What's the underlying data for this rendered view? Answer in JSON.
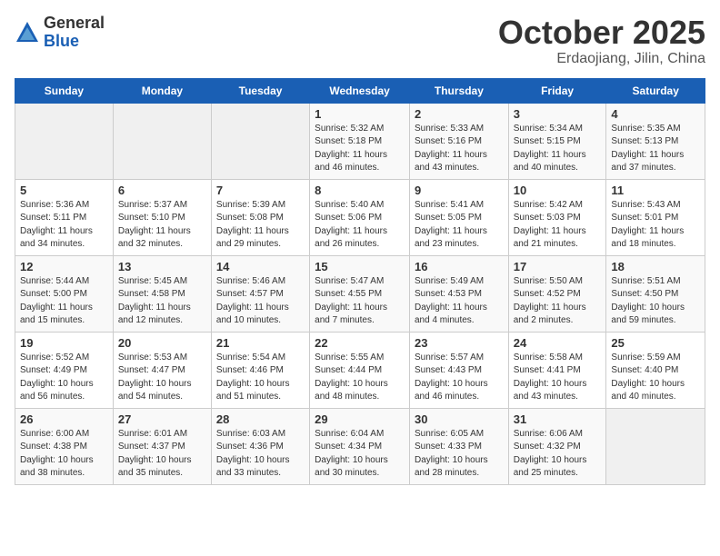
{
  "logo": {
    "general": "General",
    "blue": "Blue"
  },
  "title": "October 2025",
  "location": "Erdaojiang, Jilin, China",
  "days_of_week": [
    "Sunday",
    "Monday",
    "Tuesday",
    "Wednesday",
    "Thursday",
    "Friday",
    "Saturday"
  ],
  "weeks": [
    [
      {
        "day": "",
        "info": ""
      },
      {
        "day": "",
        "info": ""
      },
      {
        "day": "",
        "info": ""
      },
      {
        "day": "1",
        "info": "Sunrise: 5:32 AM\nSunset: 5:18 PM\nDaylight: 11 hours\nand 46 minutes."
      },
      {
        "day": "2",
        "info": "Sunrise: 5:33 AM\nSunset: 5:16 PM\nDaylight: 11 hours\nand 43 minutes."
      },
      {
        "day": "3",
        "info": "Sunrise: 5:34 AM\nSunset: 5:15 PM\nDaylight: 11 hours\nand 40 minutes."
      },
      {
        "day": "4",
        "info": "Sunrise: 5:35 AM\nSunset: 5:13 PM\nDaylight: 11 hours\nand 37 minutes."
      }
    ],
    [
      {
        "day": "5",
        "info": "Sunrise: 5:36 AM\nSunset: 5:11 PM\nDaylight: 11 hours\nand 34 minutes."
      },
      {
        "day": "6",
        "info": "Sunrise: 5:37 AM\nSunset: 5:10 PM\nDaylight: 11 hours\nand 32 minutes."
      },
      {
        "day": "7",
        "info": "Sunrise: 5:39 AM\nSunset: 5:08 PM\nDaylight: 11 hours\nand 29 minutes."
      },
      {
        "day": "8",
        "info": "Sunrise: 5:40 AM\nSunset: 5:06 PM\nDaylight: 11 hours\nand 26 minutes."
      },
      {
        "day": "9",
        "info": "Sunrise: 5:41 AM\nSunset: 5:05 PM\nDaylight: 11 hours\nand 23 minutes."
      },
      {
        "day": "10",
        "info": "Sunrise: 5:42 AM\nSunset: 5:03 PM\nDaylight: 11 hours\nand 21 minutes."
      },
      {
        "day": "11",
        "info": "Sunrise: 5:43 AM\nSunset: 5:01 PM\nDaylight: 11 hours\nand 18 minutes."
      }
    ],
    [
      {
        "day": "12",
        "info": "Sunrise: 5:44 AM\nSunset: 5:00 PM\nDaylight: 11 hours\nand 15 minutes."
      },
      {
        "day": "13",
        "info": "Sunrise: 5:45 AM\nSunset: 4:58 PM\nDaylight: 11 hours\nand 12 minutes."
      },
      {
        "day": "14",
        "info": "Sunrise: 5:46 AM\nSunset: 4:57 PM\nDaylight: 11 hours\nand 10 minutes."
      },
      {
        "day": "15",
        "info": "Sunrise: 5:47 AM\nSunset: 4:55 PM\nDaylight: 11 hours\nand 7 minutes."
      },
      {
        "day": "16",
        "info": "Sunrise: 5:49 AM\nSunset: 4:53 PM\nDaylight: 11 hours\nand 4 minutes."
      },
      {
        "day": "17",
        "info": "Sunrise: 5:50 AM\nSunset: 4:52 PM\nDaylight: 11 hours\nand 2 minutes."
      },
      {
        "day": "18",
        "info": "Sunrise: 5:51 AM\nSunset: 4:50 PM\nDaylight: 10 hours\nand 59 minutes."
      }
    ],
    [
      {
        "day": "19",
        "info": "Sunrise: 5:52 AM\nSunset: 4:49 PM\nDaylight: 10 hours\nand 56 minutes."
      },
      {
        "day": "20",
        "info": "Sunrise: 5:53 AM\nSunset: 4:47 PM\nDaylight: 10 hours\nand 54 minutes."
      },
      {
        "day": "21",
        "info": "Sunrise: 5:54 AM\nSunset: 4:46 PM\nDaylight: 10 hours\nand 51 minutes."
      },
      {
        "day": "22",
        "info": "Sunrise: 5:55 AM\nSunset: 4:44 PM\nDaylight: 10 hours\nand 48 minutes."
      },
      {
        "day": "23",
        "info": "Sunrise: 5:57 AM\nSunset: 4:43 PM\nDaylight: 10 hours\nand 46 minutes."
      },
      {
        "day": "24",
        "info": "Sunrise: 5:58 AM\nSunset: 4:41 PM\nDaylight: 10 hours\nand 43 minutes."
      },
      {
        "day": "25",
        "info": "Sunrise: 5:59 AM\nSunset: 4:40 PM\nDaylight: 10 hours\nand 40 minutes."
      }
    ],
    [
      {
        "day": "26",
        "info": "Sunrise: 6:00 AM\nSunset: 4:38 PM\nDaylight: 10 hours\nand 38 minutes."
      },
      {
        "day": "27",
        "info": "Sunrise: 6:01 AM\nSunset: 4:37 PM\nDaylight: 10 hours\nand 35 minutes."
      },
      {
        "day": "28",
        "info": "Sunrise: 6:03 AM\nSunset: 4:36 PM\nDaylight: 10 hours\nand 33 minutes."
      },
      {
        "day": "29",
        "info": "Sunrise: 6:04 AM\nSunset: 4:34 PM\nDaylight: 10 hours\nand 30 minutes."
      },
      {
        "day": "30",
        "info": "Sunrise: 6:05 AM\nSunset: 4:33 PM\nDaylight: 10 hours\nand 28 minutes."
      },
      {
        "day": "31",
        "info": "Sunrise: 6:06 AM\nSunset: 4:32 PM\nDaylight: 10 hours\nand 25 minutes."
      },
      {
        "day": "",
        "info": ""
      }
    ]
  ]
}
